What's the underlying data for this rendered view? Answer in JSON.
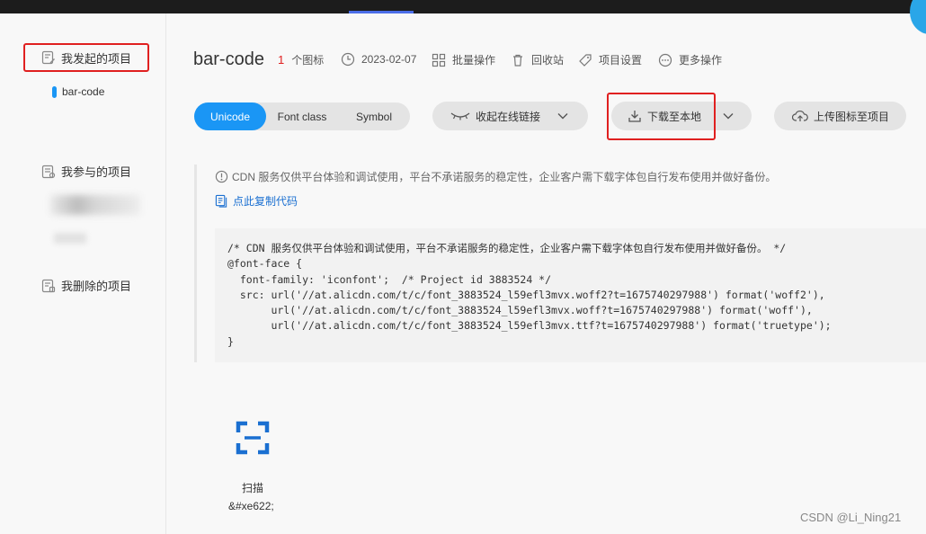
{
  "sidebar": {
    "items": [
      {
        "label": "我发起的项目"
      },
      {
        "label": "我参与的项目"
      },
      {
        "label": "我删除的项目"
      }
    ],
    "sub_item": "bar-code"
  },
  "header": {
    "title": "bar-code",
    "icon_count": "1",
    "icon_count_suffix": "个图标",
    "date": "2023-02-07",
    "batch": "批量操作",
    "trash": "回收站",
    "settings": "项目设置",
    "more": "更多操作"
  },
  "toolbar": {
    "tabs": [
      "Unicode",
      "Font class",
      "Symbol"
    ],
    "collapse_link": "收起在线链接",
    "download": "下载至本地",
    "upload": "上传图标至项目"
  },
  "notice": {
    "text": "CDN 服务仅供平台体验和调试使用，平台不承诺服务的稳定性，企业客户需下载字体包自行发布使用并做好备份。",
    "copy": "点此复制代码"
  },
  "code": {
    "lines": [
      "/* CDN 服务仅供平台体验和调试使用，平台不承诺服务的稳定性，企业客户需下载字体包自行发布使用并做好备份。 */",
      "@font-face {",
      "  font-family: 'iconfont';  /* Project id 3883524 */",
      "  src: url('//at.alicdn.com/t/c/font_3883524_l59efl3mvx.woff2?t=1675740297988') format('woff2'),",
      "       url('//at.alicdn.com/t/c/font_3883524_l59efl3mvx.woff?t=1675740297988') format('woff'),",
      "       url('//at.alicdn.com/t/c/font_3883524_l59efl3mvx.ttf?t=1675740297988') format('truetype');",
      "}"
    ]
  },
  "icon": {
    "name": "扫描",
    "code": "&#xe622;"
  },
  "watermark": "CSDN @Li_Ning21",
  "colors": {
    "accent": "#1a96f5",
    "highlight_red": "#e02020",
    "link": "#1a6fd1"
  }
}
